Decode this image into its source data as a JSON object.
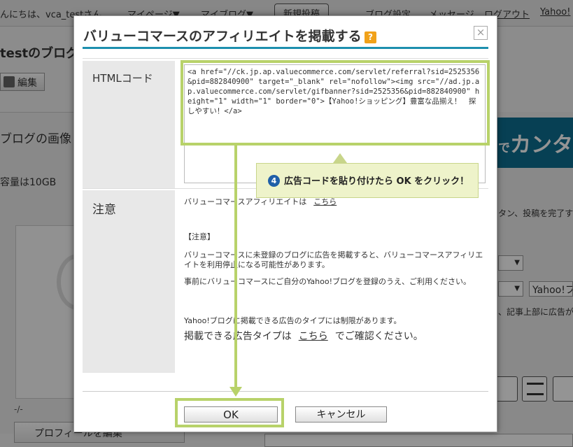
{
  "background": {
    "top_nav": {
      "greeting": "んにちは、vca_testさん",
      "my_page": "マイページ▼",
      "my_blog": "マイブログ▼",
      "new_post": "新規投稿",
      "blog_settings": "ブログ設定",
      "message": "メッセージ",
      "logout": "ログアウト",
      "yahoo": "Yahoo!"
    },
    "blog_title": "testのブログ",
    "edit_label": "編集",
    "blog_image_heading": "ブログの画像",
    "capacity_text": "容量は10GB",
    "banner_small": "で",
    "banner_text": "カンタ",
    "right_hint": "タン、投稿を完了す",
    "yahoo_field": "Yahoo!フ",
    "right_hint2": "、記事上部に広告が",
    "slash_mark": "-/-",
    "profile_button": "プロフィールを編集",
    "select_arrow": "▼"
  },
  "modal": {
    "title": "バリューコマースのアフィリエイトを掲載する",
    "help_icon": "?",
    "close_icon": "×",
    "html_code_label": "HTMLコード",
    "html_code_value": "<a href=\"//ck.jp.ap.valuecommerce.com/servlet/referral?sid=2525356&pid=882840900\" target=\"_blank\" rel=\"nofollow\"><img src=\"//ad.jp.ap.valuecommerce.com/servlet/gifbanner?sid=2525356&pid=882840900\" height=\"1\" width=\"1\" border=\"0\">【Yahoo!ショッピング】豊富な品揃え！　探しやすい！</a>",
    "note_label": "注意",
    "note_affiliate_prefix": "バリューコマースアフィリエイトは",
    "note_link_here": "こちら",
    "note_heading": "【注意】",
    "note_para1": "バリューコマースに未登録のブログに広告を掲載すると、バリューコマースアフィリエイトを利用停止になる可能性があります。",
    "note_para2": "事前にバリューコマースにご自分のYahoo!ブログを登録のうえ、ご利用ください。",
    "note_para3": "Yahoo!ブログに掲載できる広告のタイプには制限があります。",
    "note_ad_types_prefix": "掲載できる広告タイプは",
    "note_ad_types_suffix": "でご確認ください。",
    "ok_label": "OK",
    "cancel_label": "キャンセル"
  },
  "annotation": {
    "step_number": "4",
    "callout_text": "広告コードを貼り付けたら OK をクリック！"
  }
}
